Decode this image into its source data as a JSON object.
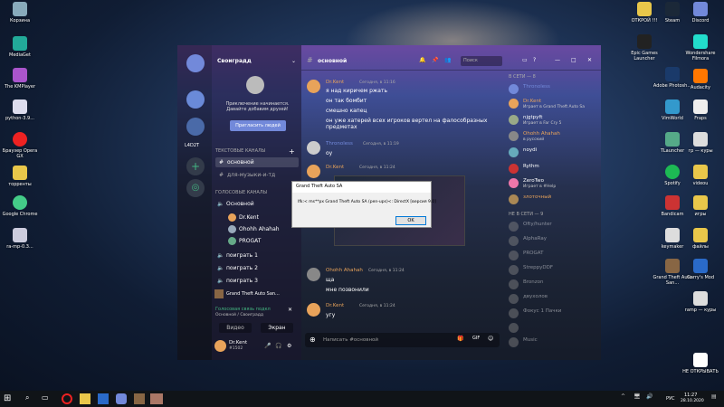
{
  "desktop": {
    "left": [
      "Корзина",
      "MediaGet",
      "The KMPlayer",
      "python-3.9...",
      "Браузер Opera GX",
      "торренты",
      "Google Chrome",
      "ra-mp-0.3..."
    ],
    "right1": [
      "ОТКРОЙ !!!",
      "Epic Games Launcher",
      "Adobe Photosh...",
      "VimWorld",
      "TLauncher",
      "Spotify",
      "Bandicam",
      "keymaker",
      "Grand Theft Auto San..."
    ],
    "right2": [
      "Steam",
      "Discord",
      "Wondershare Filmora",
      "Audacity",
      "Fraps",
      "гр — куры",
      "videou",
      "игры",
      "файлы",
      "Garry's Mod",
      "ramp — куры",
      "НЕ ОТКРЫВАТЬ"
    ]
  },
  "discord": {
    "server_name": "Своиградд",
    "guild_label": "L4D2T",
    "welcome": "Приключение начинается. Давайте добавим друзей!",
    "invite_button": "Пригласить людей",
    "text_category": "ТЕКСТОВЫЕ КАНАЛЫ",
    "text_channels": [
      "основной",
      "для-музыки-и-тд"
    ],
    "voice_category": "ГОЛОСОВЫЕ КАНАЛЫ",
    "voice_channels": [
      "Основной",
      "поиграть 1",
      "поиграть 2",
      "поиграть 3"
    ],
    "voice_users": [
      "Dr.Kent",
      "Ohohh Ahahah",
      "PROGAT"
    ],
    "activity": "Grand Theft Auto San...",
    "voice_status": "Голосовая связь подкл",
    "voice_location": "Основной / Своиградд",
    "video_label": "Видео",
    "screen_label": "Экран",
    "user_name": "Dr.Kent",
    "user_tag": "#1502",
    "channel_title": "основной",
    "search_placeholder": "Поиск",
    "input_placeholder": "Написать #основной",
    "messages": [
      {
        "author": "Dr.Kent",
        "time": "Сегодня, в 11:16",
        "lines": [
          "я над киричем ржать",
          "он так бомбит",
          "смешно капец",
          "он уже хатерей всех игроков вертел на фалособразных предметах"
        ],
        "color": "#e8a35a"
      },
      {
        "author": "Thronoless",
        "time": "Сегодня, в 11:19",
        "lines": [
          "оу"
        ],
        "color": "#7289da"
      },
      {
        "author": "Dr.Kent",
        "time": "Сегодня, в 11:24",
        "lines": [
          ""
        ],
        "color": "#e8a35a"
      },
      {
        "author": "Ohohh Ahahah",
        "time": "Сегодня, в 11:24",
        "lines": [
          "ща",
          "мне позвонили"
        ],
        "color": "#e8a35a"
      },
      {
        "author": "Dr.Kent",
        "time": "Сегодня, в 11:24",
        "lines": [
          "угу"
        ],
        "color": "#e8a35a"
      }
    ],
    "online_header": "В СЕТИ — 8",
    "online": [
      {
        "n": "Thronoless",
        "s": "",
        "c": "#7289da"
      },
      {
        "n": "Dr.Kent",
        "s": "Играет в Grand Theft Auto Sa",
        "c": "#e8a35a"
      },
      {
        "n": "njgtpyft",
        "s": "Играет в Far Cry 5",
        "c": "#fff"
      },
      {
        "n": "Ohohh Ahahah",
        "s": "в русский",
        "c": "#e8a35a"
      },
      {
        "n": "noydi",
        "s": "",
        "c": "#fff"
      },
      {
        "n": "Rythm",
        "s": "",
        "c": "#fff"
      },
      {
        "n": "ZeroTwo",
        "s": "Играет в #Help",
        "c": "#fff"
      },
      {
        "n": "злоточный",
        "s": "",
        "c": "#e8a35a"
      }
    ],
    "offline_header": "НЕ В СЕТИ — 9",
    "offline": [
      "Ofty/hunter",
      "AlphaRay",
      "PROGAT",
      "StreppyDDF",
      "Bronzon",
      "двухолов",
      "Фокус 1 Пачки",
      "",
      "Music"
    ]
  },
  "dialog": {
    "title": "Grand Theft Auto SA",
    "text": "Ifk:< ms**px Grand Theft Auto SA (pen-ups)<: DirectX [версия 9.0]",
    "ok": "OK"
  },
  "taskbar": {
    "lang": "РУС",
    "time": "11:27",
    "date": "28.10.2020"
  }
}
